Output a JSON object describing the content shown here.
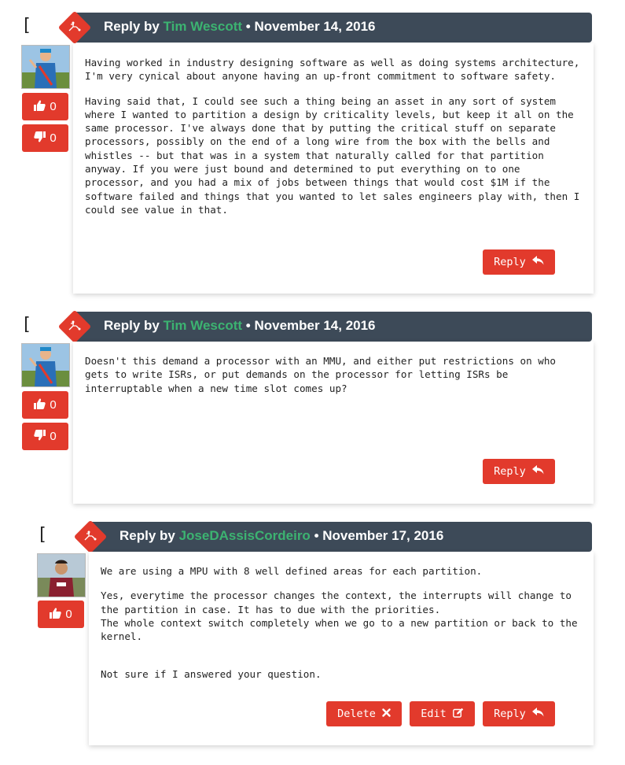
{
  "comments": [
    {
      "collapse": "[ - ]",
      "reply_by": "Reply by",
      "author": "Tim Wescott",
      "separator": "•",
      "date": "November 14, 2016",
      "upvotes": "0",
      "downvotes": "0",
      "paragraphs": [
        "Having worked in industry designing software as well as doing systems architecture, I'm very cynical about anyone having an up-front commitment to software safety.",
        "Having said that, I could see such a thing being an asset in any sort of system where I wanted to partition a design by criticality levels, but keep it all on the same processor.  I've always done that by putting the critical stuff on separate processors, possibly on the end of a long wire from the box with the bells and whistles -- but that was in a system that naturally called for that partition anyway.  If you were just bound and determined to put everything on to one processor, and you had a mix of jobs between things that would cost $1M if the software failed and things that you wanted to let sales engineers play with, then I could see value in that."
      ],
      "reply_label": "Reply"
    },
    {
      "collapse": "[ - ]",
      "reply_by": "Reply by",
      "author": "Tim Wescott",
      "separator": "•",
      "date": "November 14, 2016",
      "upvotes": "0",
      "downvotes": "0",
      "paragraphs": [
        "Doesn't this demand a processor with an MMU, and either put restrictions on who gets to write ISRs, or put demands on the processor for letting ISRs be interruptable when a new time slot comes up?"
      ],
      "reply_label": "Reply"
    },
    {
      "collapse": "[ - ]",
      "reply_by": "Reply by",
      "author": "JoseDAssisCordeiro",
      "separator": "•",
      "date": "November 17, 2016",
      "upvotes": "0",
      "paragraphs": [
        "We are using a MPU with 8 well defined areas for each partition.",
        "Yes, everytime the processor changes the context, the interrupts will change to the partition in case. It has to due with the priorities.\nThe whole context switch completely when we go to a new partition or back to the kernel.",
        "Not sure if I answered your question."
      ],
      "delete_label": "Delete",
      "edit_label": "Edit",
      "reply_label": "Reply"
    }
  ],
  "icons": {
    "badge": "circuit-icon",
    "upvote": "thumbs-up-icon",
    "downvote": "thumbs-down-icon",
    "reply": "reply-arrow-icon",
    "delete": "close-icon",
    "edit": "edit-icon"
  },
  "colors": {
    "accent": "#e23a2c",
    "header": "#3d4a58",
    "author": "#3cb371"
  }
}
